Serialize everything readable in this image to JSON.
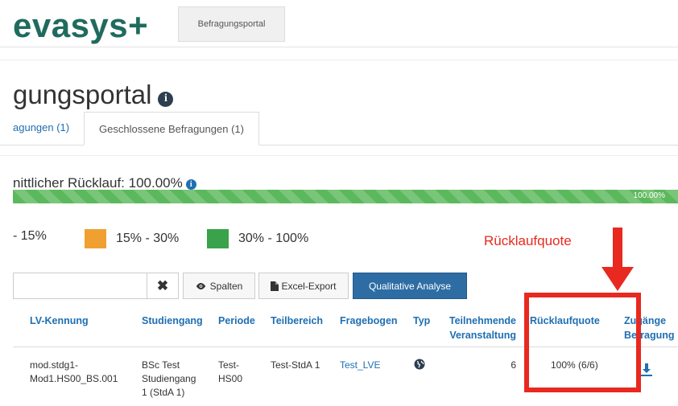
{
  "header": {
    "logo": "evasys+",
    "tab_label": "Befragungsportal"
  },
  "page": {
    "title": "gungsportal"
  },
  "tabs": {
    "open_label": "agungen (1)",
    "closed_label": "Geschlossene Befragungen (1)"
  },
  "response": {
    "avg_label": "nittlicher Rücklauf: 100.00%",
    "progress_value": 100,
    "progress_text": "100.00%"
  },
  "legend": {
    "items": [
      {
        "label": "- 15%",
        "color": ""
      },
      {
        "label": "15% - 30%",
        "color": "#f0a030"
      },
      {
        "label": "30% - 100%",
        "color": "#3aa24b"
      }
    ]
  },
  "annotation": {
    "label": "Rücklaufquote",
    "color": "#e8291f"
  },
  "toolbar": {
    "clear_label": "✖",
    "spalten_label": "Spalten",
    "excel_label": "Excel-Export",
    "qual_label": "Qualitative Analyse"
  },
  "table": {
    "headers": {
      "lv_kennung": "LV-Kennung",
      "studiengang": "Studiengang",
      "periode": "Periode",
      "teilbereich": "Teilbereich",
      "fragebogen": "Fragebogen",
      "typ": "Typ",
      "teilnehmende_1": "Teilnehmende",
      "teilnehmende_2": "Veranstaltung",
      "ruecklaufquote": "Rücklaufquote",
      "zugaenge_1": "Zugänge",
      "zugaenge_2": "Befragung"
    },
    "row": {
      "lv_kennung_1": "mod.stdg1-",
      "lv_kennung_2": "Mod1.HS00_BS.001",
      "studiengang_1": "BSc Test",
      "studiengang_2": "Studiengang",
      "studiengang_3": "1 (StdA 1)",
      "periode_1": "Test-",
      "periode_2": "HS00",
      "teilbereich": "Test-StdA 1",
      "fragebogen": "Test_LVE",
      "teilnehmende": "6",
      "ruecklaufquote": "100% (6/6)"
    }
  },
  "icons": {
    "info": "info-icon",
    "eye": "eye-icon",
    "file": "file-icon",
    "globe": "globe-icon",
    "download": "download-icon"
  },
  "colors": {
    "brand": "#1f6b5e",
    "link": "#1f6fb2",
    "progress": "#5cb85c",
    "primary_button": "#2e6da4",
    "annotation": "#e8291f"
  }
}
